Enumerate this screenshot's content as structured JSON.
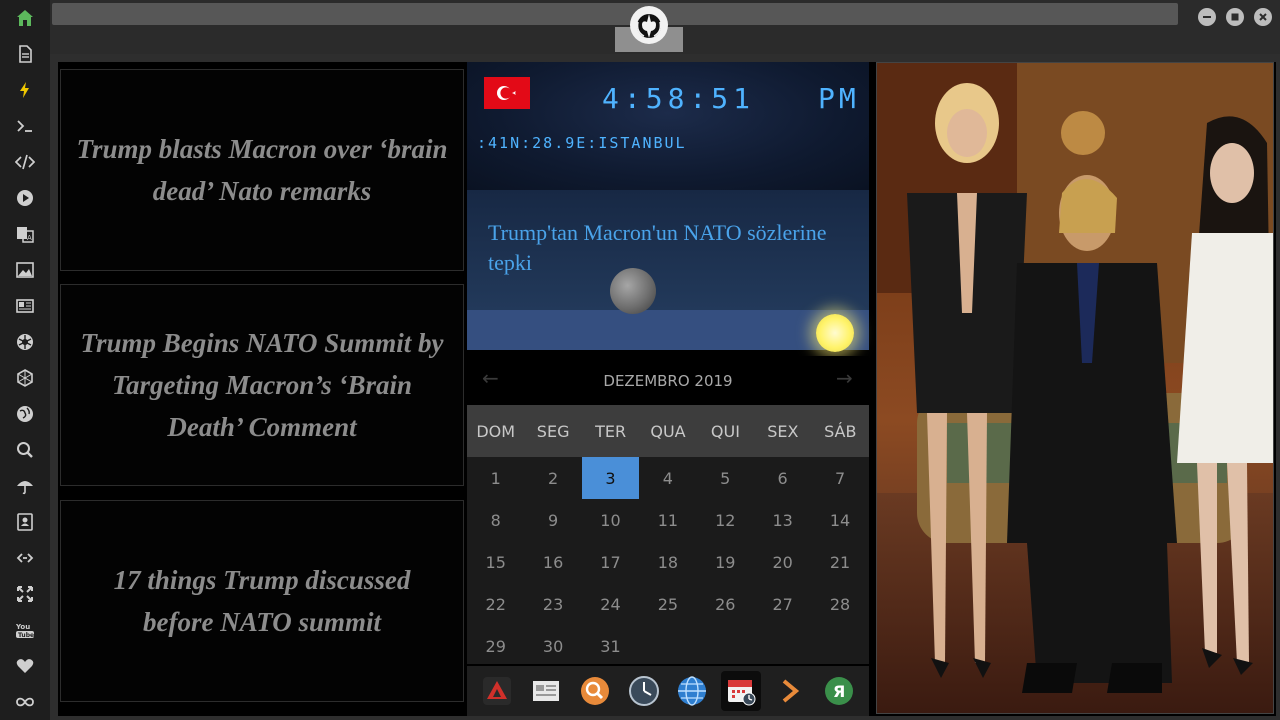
{
  "sidebar": {
    "icons": [
      "home-icon",
      "document-icon",
      "bolt-icon",
      "terminal-icon",
      "code-icon",
      "play-icon",
      "translate-icon",
      "image-icon",
      "news-icon",
      "rebel-alliance-icon",
      "empire-icon",
      "globe-icon",
      "search-icon",
      "umbrella-icon",
      "contacts-icon",
      "link-icon",
      "expand-icon",
      "youtube-icon",
      "heart-icon",
      "infinity-icon"
    ],
    "active_color": "#5cb85c",
    "bolt_color": "#f0c800"
  },
  "window": {
    "controls": [
      "minimize",
      "maximize",
      "close"
    ]
  },
  "news": [
    {
      "title": "Trump blasts Macron over ‘brain dead’ Nato remarks"
    },
    {
      "title": "Trump Begins NATO Summit by Targeting Macron’s ‘Brain Death’ Comment"
    },
    {
      "title": "17 things Trump discussed before NATO summit"
    }
  ],
  "clock": {
    "time": "4:58:51",
    "ampm": "PM",
    "location": ":41N:28.9E:ISTANBUL",
    "flag": "turkey-flag"
  },
  "weather": {
    "headline": "Trump'tan Macron'un NATO sözlerine tepki"
  },
  "calendar": {
    "month": "DEZEMBRO 2019",
    "weekdays": [
      "DOM",
      "SEG",
      "TER",
      "QUA",
      "QUI",
      "SEX",
      "SÁB"
    ],
    "selected": "3",
    "leading_blanks": 0,
    "days": [
      "1",
      "2",
      "3",
      "4",
      "5",
      "6",
      "7",
      "8",
      "9",
      "10",
      "11",
      "12",
      "13",
      "14",
      "15",
      "16",
      "17",
      "18",
      "19",
      "20",
      "21",
      "22",
      "23",
      "24",
      "25",
      "26",
      "27",
      "28",
      "29",
      "30",
      "31"
    ]
  },
  "dock": {
    "items": [
      "rebel-app-icon",
      "news-reader-icon",
      "search-app-icon",
      "clock-app-icon",
      "browser-globe-icon",
      "calendar-app-icon",
      "play-forward-icon",
      "yandex-icon"
    ],
    "active": "calendar-app-icon"
  },
  "colors": {
    "lcd": "#4fb3ff",
    "selected_day": "#4a8fd8",
    "headline": "#4aa3ea"
  }
}
